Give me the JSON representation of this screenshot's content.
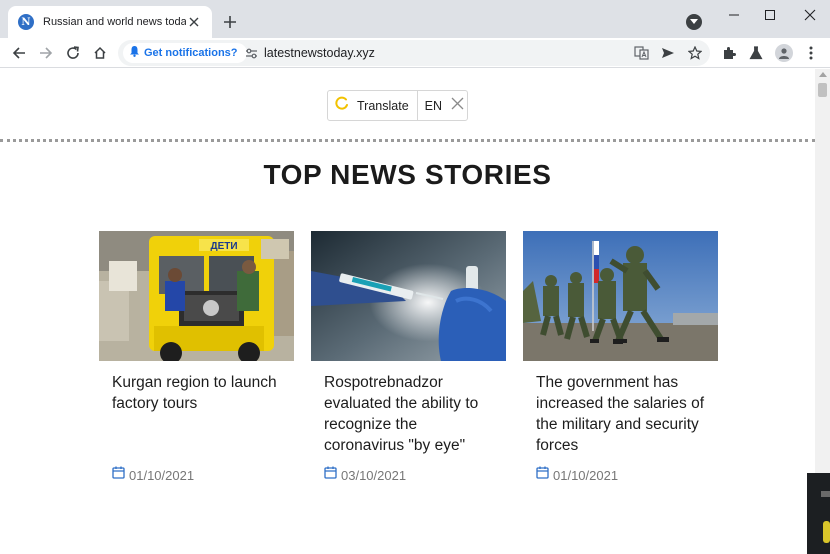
{
  "browser": {
    "tab_title": "Russian and world news today",
    "favicon_letter": "N",
    "notification_chip": "Get notifications?",
    "url": "latestnewstoday.xyz",
    "accent": "#1a73e8"
  },
  "translate": {
    "label": "Translate",
    "lang": "EN"
  },
  "page": {
    "section_title": "TOP NEWS STORIES",
    "cards": [
      {
        "title": "Kurgan region to launch factory tours",
        "date": "01/10/2021"
      },
      {
        "title": "Rospotrebnadzor evaluated the ability to recognize the coronavirus \"by eye\"",
        "date": "03/10/2021"
      },
      {
        "title": "The government has increased the salaries of the military and security forces",
        "date": "01/10/2021"
      }
    ],
    "bus_sign": "ДЕТИ"
  }
}
